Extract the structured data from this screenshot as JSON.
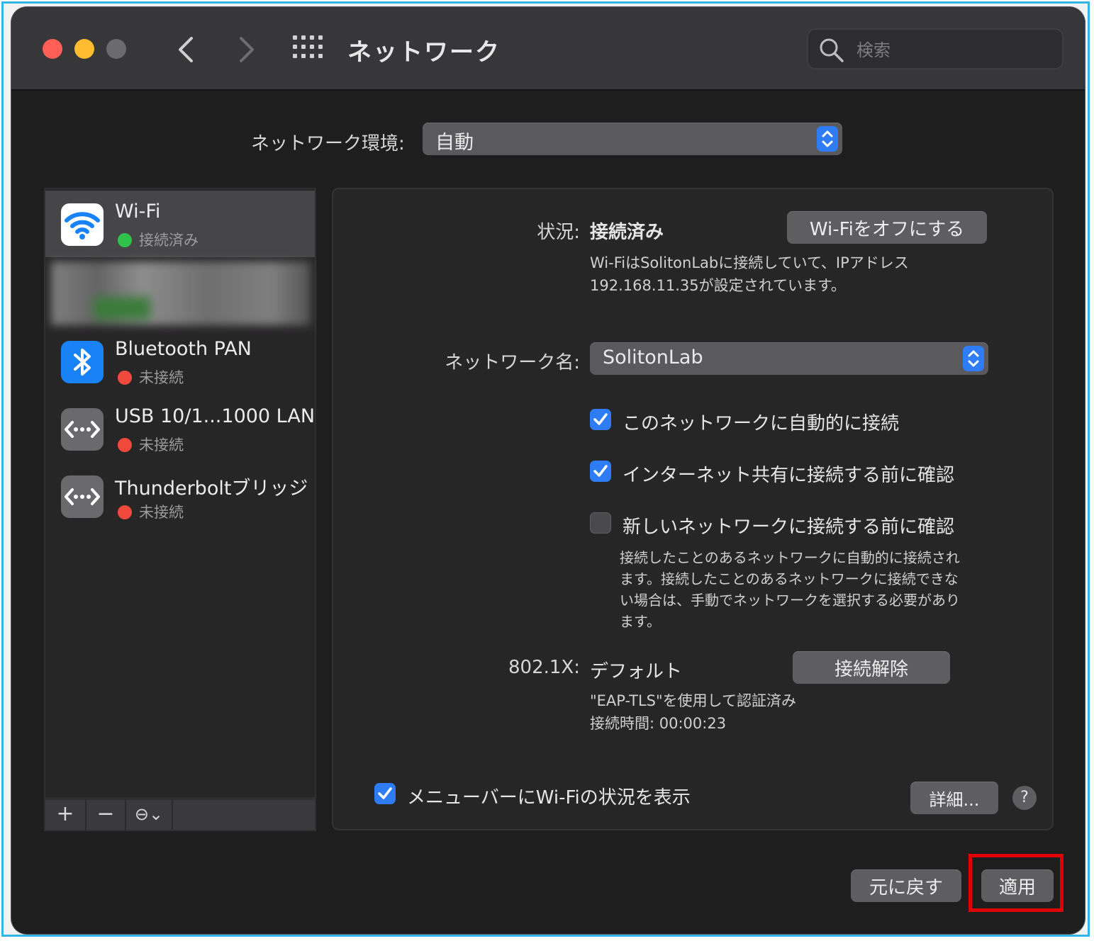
{
  "window": {
    "title": "ネットワーク",
    "search_placeholder": "検索"
  },
  "location": {
    "label": "ネットワーク環境:",
    "value": "自動"
  },
  "services": [
    {
      "name": "Wi-Fi",
      "status": "接続済み",
      "status_color": "#30c24a",
      "icon": "wifi-icon"
    },
    {
      "name": "Bluetooth PAN",
      "status": "未接続",
      "status_color": "#f04a3f",
      "icon": "bluetooth-icon"
    },
    {
      "name": "USB 10/1...1000 LAN",
      "status": "未接続",
      "status_color": "#f04a3f",
      "icon": "ethernet-icon"
    },
    {
      "name": "Thunderboltブリッジ",
      "status": "未接続",
      "status_color": "#f04a3f",
      "icon": "ethernet-icon"
    }
  ],
  "sidebar_toolbar": {
    "add": "+",
    "remove": "−",
    "action": "⊖⌄"
  },
  "detail": {
    "status_label": "状況:",
    "status_value": "接続済み",
    "wifi_off_button": "Wi-Fiをオフにする",
    "status_desc_line1": "Wi-FiはSolitonLabに接続していて、IPアドレス",
    "status_desc_line2": "192.168.11.35が設定されています。",
    "network_name_label": "ネットワーク名:",
    "network_name_value": "SolitonLab",
    "checkboxes": [
      {
        "label": "このネットワークに自動的に接続",
        "checked": true
      },
      {
        "label": "インターネット共有に接続する前に確認",
        "checked": true
      },
      {
        "label": "新しいネットワークに接続する前に確認",
        "checked": false
      }
    ],
    "join_note_lines": [
      "接続したことのあるネットワークに自動的に接続され",
      "ます。接続したことのあるネットワークに接続できな",
      "い場合は、手動でネットワークを選択する必要があり",
      "ます。"
    ],
    "dot1x_label": "802.1X:",
    "dot1x_value": "デフォルト",
    "disconnect_button": "接続解除",
    "auth_line": "\"EAP-TLS\"を使用して認証済み",
    "connect_time": "接続時間: 00:00:23",
    "menubar_checkbox": "メニューバーにWi-Fiの状況を表示",
    "advanced_button": "詳細...",
    "help": "?"
  },
  "footer": {
    "revert_button": "元に戻す",
    "apply_button": "適用"
  },
  "colors": {
    "accent": "#2f7df6",
    "highlight": "#e00000",
    "frame": "#33b5e5"
  }
}
